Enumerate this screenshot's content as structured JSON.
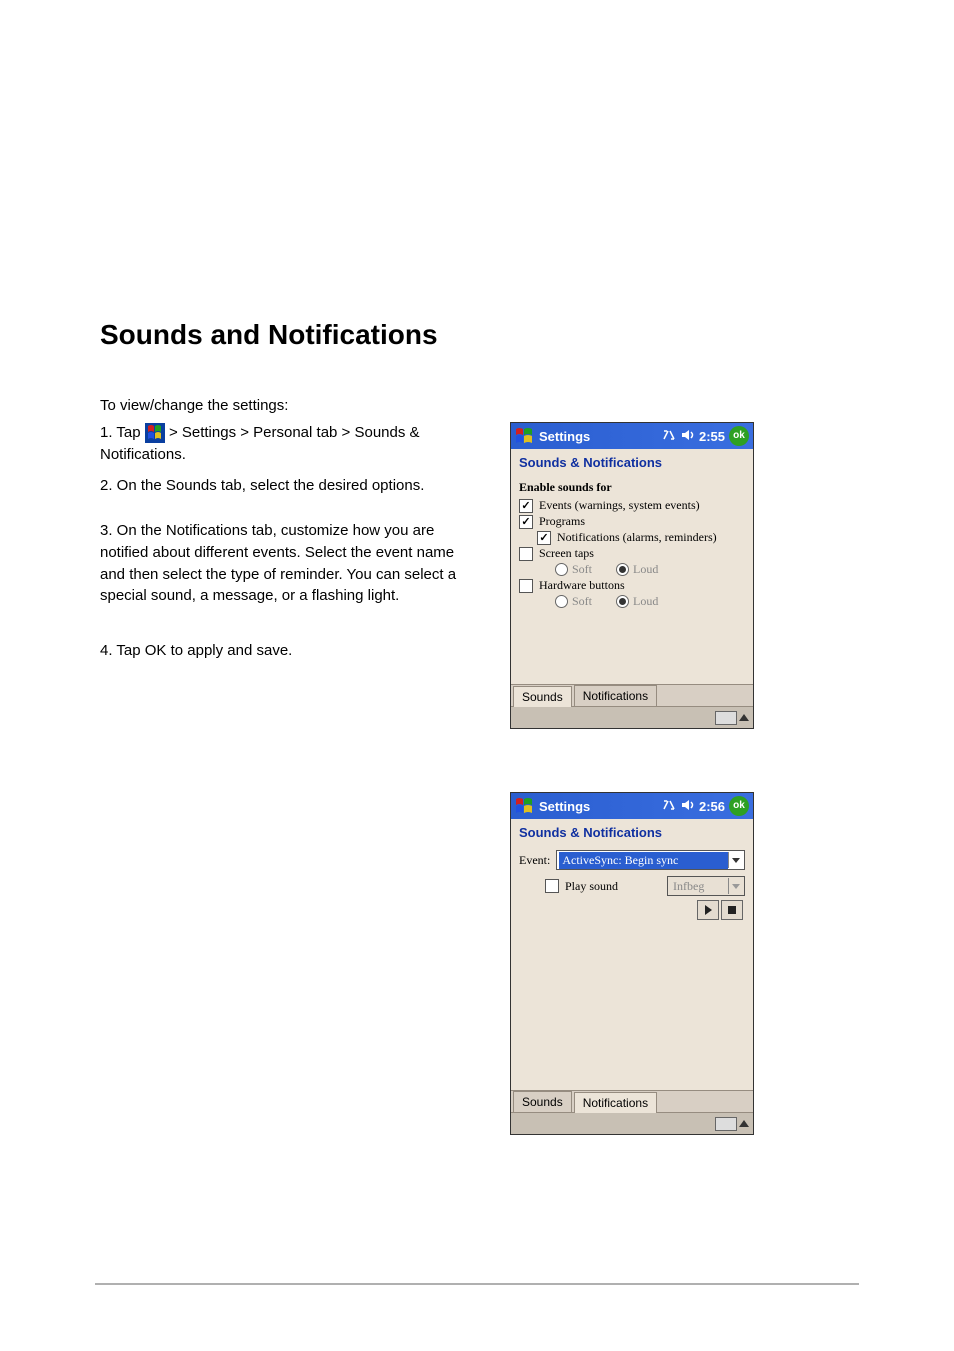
{
  "doc": {
    "section_heading": "Sounds and Notifications",
    "instruction_line1": "To view/change the settings:",
    "step1_prefix": "1. Tap ",
    "step1_suffix": " > Settings > Personal tab > Sounds & Notifications.",
    "step2": "2. On the Sounds tab, select the desired options.",
    "step3": "3. On the Notifications tab, customize how you are notified about different events. Select the event name and then select the type of reminder. You can select a special sound, a message, or a flashing light.",
    "step4": "4. Tap OK to apply and save."
  },
  "shot1": {
    "title": "Settings",
    "time": "2:55",
    "ok": "ok",
    "subtitle": "Sounds & Notifications",
    "group": "Enable sounds for",
    "events_label": "Events (warnings, system events)",
    "events_checked": true,
    "programs_label": "Programs",
    "programs_checked": true,
    "notifs_label": "Notifications (alarms, reminders)",
    "notifs_checked": true,
    "taps_label": "Screen taps",
    "taps_checked": false,
    "taps_soft": "Soft",
    "taps_loud": "Loud",
    "hw_label": "Hardware buttons",
    "hw_checked": false,
    "hw_soft": "Soft",
    "hw_loud": "Loud",
    "tab_sounds": "Sounds",
    "tab_notifs": "Notifications"
  },
  "shot2": {
    "title": "Settings",
    "time": "2:56",
    "ok": "ok",
    "subtitle": "Sounds & Notifications",
    "event_label": "Event:",
    "event_value": "ActiveSync: Begin sync",
    "play_sound_label": "Play sound",
    "play_sound_checked": false,
    "sound_value": "Infbeg",
    "tab_sounds": "Sounds",
    "tab_notifs": "Notifications"
  }
}
